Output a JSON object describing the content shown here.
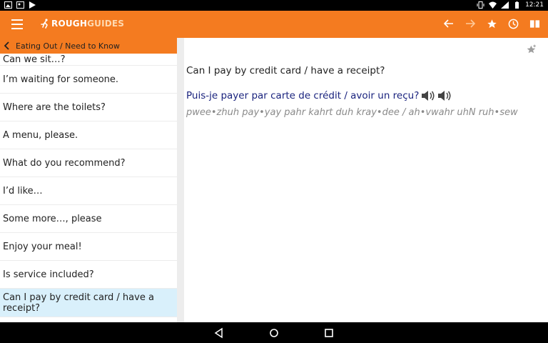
{
  "status_bar": {
    "time": "12:21"
  },
  "app_bar": {
    "logo_rough": "ROUGH",
    "logo_guides": "GUIDES"
  },
  "breadcrumb": {
    "label": "Eating Out / Need to Know"
  },
  "phrases": [
    "Can we sit…?",
    "I’m waiting for someone.",
    "Where are the toilets?",
    "A menu, please.",
    "What do you recommend?",
    "I’d like…",
    "Some more…, please",
    "Enjoy your meal!",
    "Is service included?",
    "Can I pay by credit card / have a receipt?"
  ],
  "detail": {
    "english": "Can I pay by credit card / have a receipt?",
    "french": "Puis-je payer par carte de crédit / avoir un reçu?",
    "pronunciation": "pwee•zhuh pay•yay pahr kahrt duh kray•dee / ah•vwahr uhN ruh•sew"
  },
  "colors": {
    "accent": "#f47b20",
    "selected_row": "#d9f0fb",
    "french_text": "#1a237e"
  }
}
